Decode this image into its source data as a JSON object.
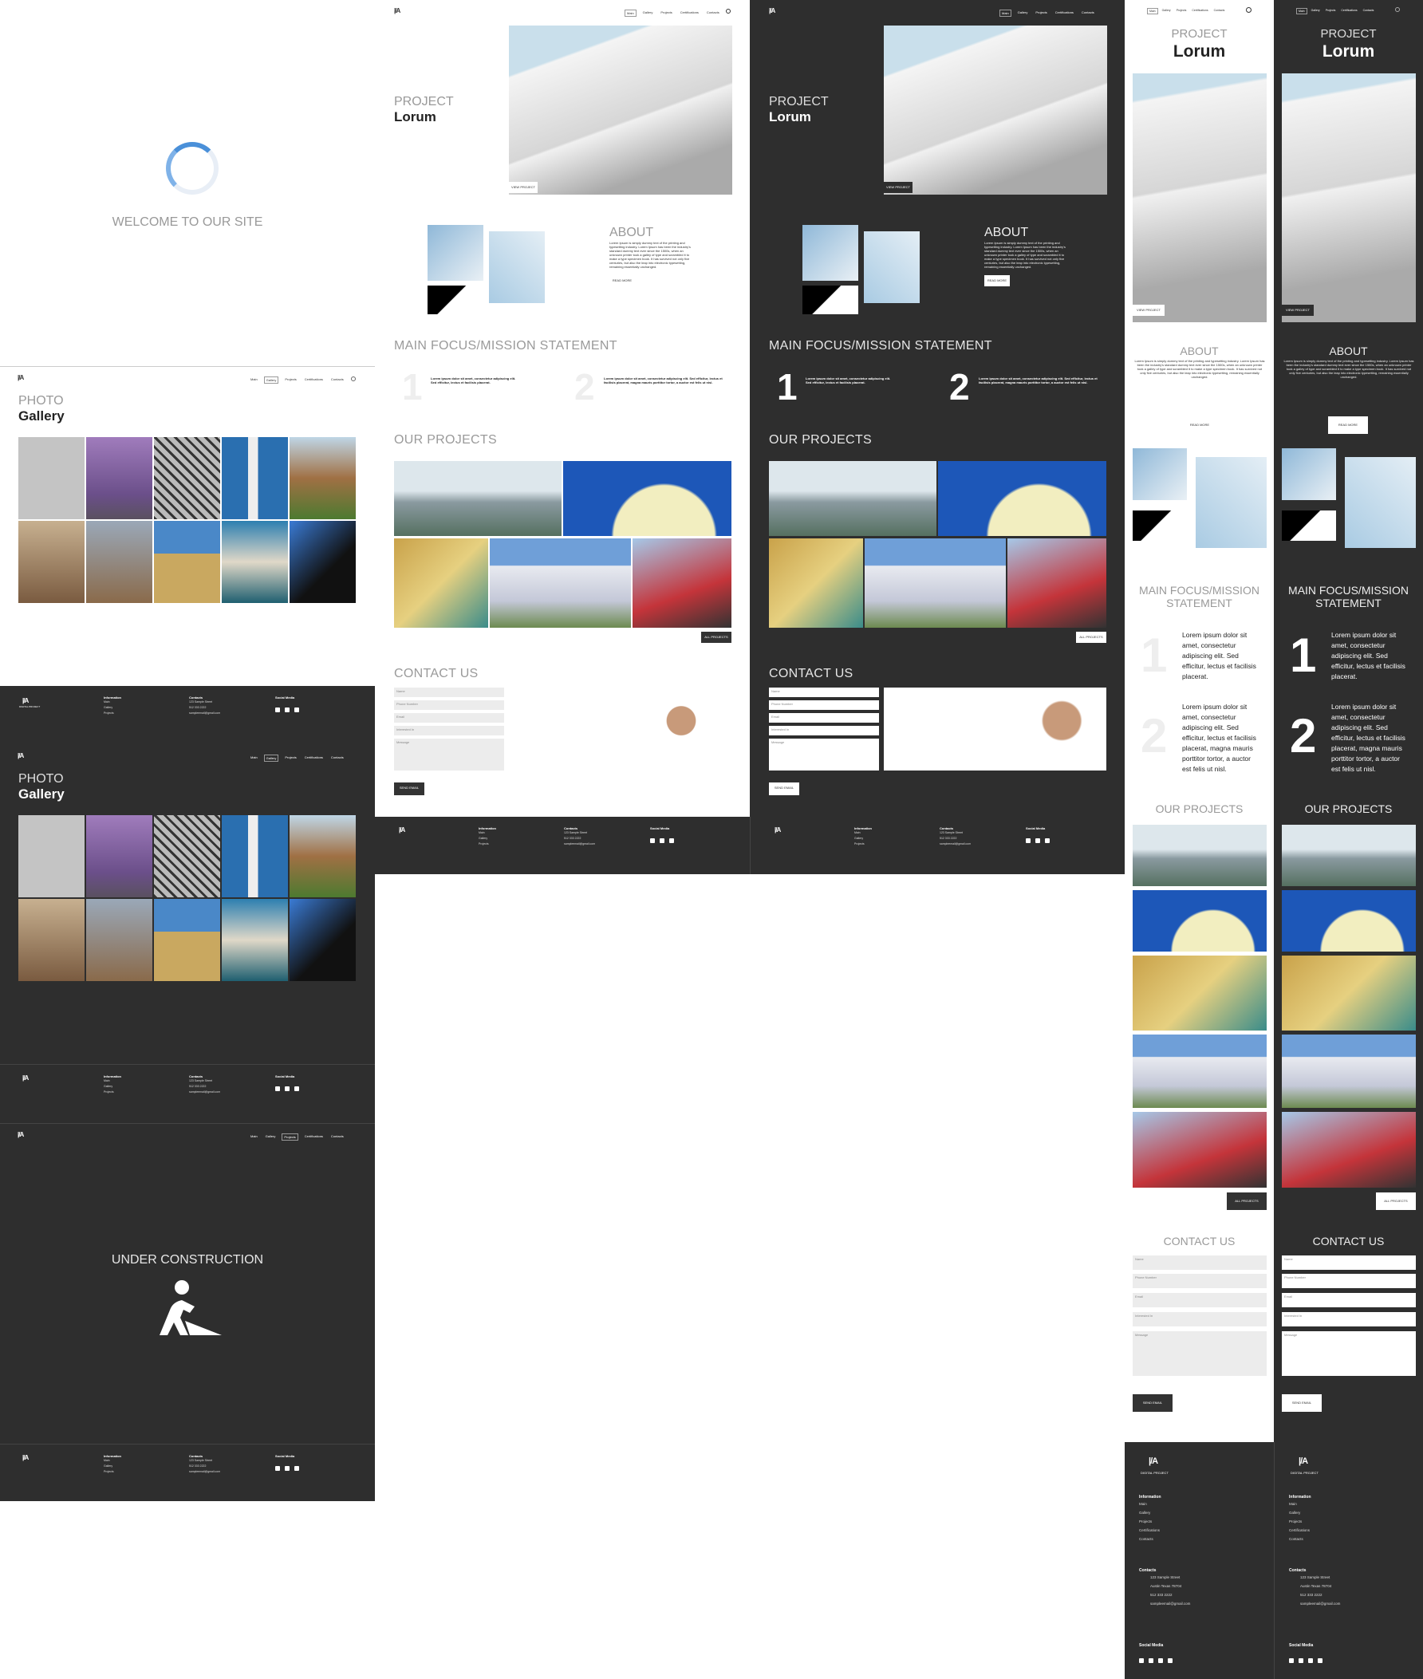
{
  "brand": {
    "logo_mark": "|/A",
    "logo_text": "DIGITAL PROJECT"
  },
  "nav": [
    "Main",
    "Gallery",
    "Projects",
    "Certifications",
    "Contacts"
  ],
  "loader": {
    "welcome": "WELCOME TO OUR SITE"
  },
  "hero": {
    "kicker": "PROJECT",
    "title": "Lorum",
    "cta": "VIEW PROJECT"
  },
  "about": {
    "title": "ABOUT",
    "body": "Lorem Ipsum is simply dummy text of the printing and typesetting industry. Lorem Ipsum has been the industry's standard dummy text ever since the 1500s, when an unknown printer took a galley of type and scrambled it to make a type specimen book. It has survived not only five centuries, but also the leap into electronic typesetting, remaining essentially unchanged.",
    "button": "READ MORE"
  },
  "mission": {
    "title": "MAIN FOCUS/MISSION STATEMENT",
    "items": [
      {
        "num": "1",
        "text": "Lorem ipsum dolor sit amet, consectetur adipiscing elit. Sed efficitur, lectus et facilisis placerat."
      },
      {
        "num": "2",
        "text": "Lorem ipsum dolor sit amet, consectetur adipiscing elit. Sed efficitur, lectus et facilisis placerat, magna mauris porttitor tortor, a auctor est felis ut nisl."
      }
    ]
  },
  "projects": {
    "title": "OUR PROJECTS",
    "button": "ALL PROJECTS"
  },
  "contact": {
    "title": "CONTACT US",
    "fields": [
      "Name",
      "Phone Number",
      "Email",
      "Interested In",
      "Message"
    ],
    "button": "SEND EMAIL"
  },
  "gallery": {
    "kicker": "PHOTO",
    "title": "Gallery"
  },
  "construction": {
    "title": "UNDER CONSTRUCTION"
  },
  "footer": {
    "info_title": "Information",
    "info_links": [
      "Main",
      "Gallery",
      "Projects",
      "Certifications",
      "Contacts"
    ],
    "contacts_title": "Contacts",
    "address1": "123 Sample Street",
    "address2": "Austin Texas 78704",
    "phone": "512 333 2222",
    "email": "sampleemail@gmail.com",
    "social_title": "Social Media"
  },
  "colors": {
    "dark": "#2e2e2e",
    "light": "#ffffff",
    "accent": "#4a90d9"
  }
}
